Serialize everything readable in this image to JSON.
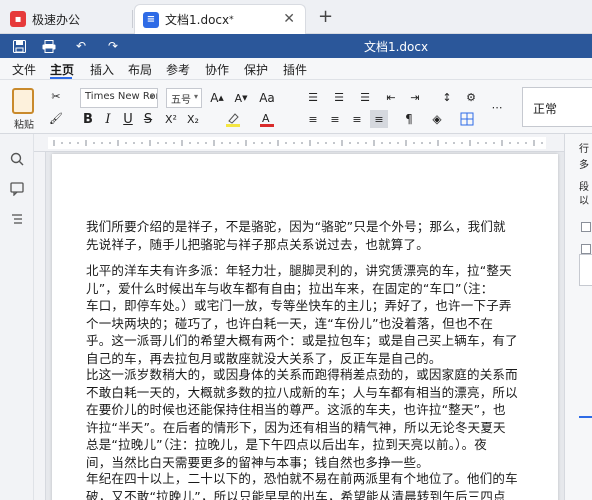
{
  "tabs": [
    {
      "label": "极速办公",
      "icon": "app-logo-icon"
    },
    {
      "label": "文档1.docx",
      "modified_mark": "*",
      "icon": "document-icon"
    }
  ],
  "window": {
    "doc_title": "文档1.docx"
  },
  "menu": {
    "items": [
      "文件",
      "主页",
      "插入",
      "布局",
      "参考",
      "协作",
      "保护",
      "插件"
    ],
    "active": "主页"
  },
  "ribbon": {
    "paste_label": "粘贴",
    "font_name": "Times New Roma",
    "font_size": "五号",
    "style_name": "正常",
    "accent_color": "#2e6be6",
    "highlight_color": "#f5e642",
    "font_color": "#d92b2b"
  },
  "right_panel": {
    "labels": [
      "行",
      "多",
      "段",
      "以"
    ]
  },
  "document": {
    "paragraphs": [
      [
        "我们所要介绍的是祥子，不是骆驼，因为“骆驼”只是个外号；那么，我们就",
        "先说祥子，随手儿把骆驼与祥子那点关系说过去，也就算了。"
      ],
      [
        "北平的洋车夫有许多派：年轻力壮，腿脚灵利的，讲究赁漂亮的车，拉“整天",
        "儿”，爱什么时候出车与收车都有自由；拉出车来，在固定的“车口”（注：",
        "车口，即停车处。）或宅门一放，专等坐快车的主儿；弄好了，也许一下子弄",
        "个一块两块的；碰巧了，也许白耗一天，连“车份儿”也没着落，但也不在",
        "乎。这一派哥儿们的希望大概有两个：或是拉包车；或是自己买上辆车，有了",
        "自己的车，再去拉包月或散座就没大关系了，反正车是自己的。"
      ],
      [
        "比这一派岁数稍大的，或因身体的关系而跑得稍差点劲的，或因家庭的关系而",
        "不敢白耗一天的，大概就多数的拉八成新的车；人与车都有相当的漂亮，所以",
        "在要价儿的时候也还能保持住相当的尊严。这派的车夫，也许拉“整天”，也",
        "许拉“半天”。在后者的情形下，因为还有相当的精气神，所以无论冬天夏天",
        "总是“拉晚儿”（注：拉晚儿，是下午四点以后出车，拉到天亮以前。）。夜",
        "间，当然比白天需要更多的留神与本事；钱自然也多挣一些。"
      ],
      [
        "年纪在四十以上，二十以下的，恐怕就不易在前两派里有个地位了。他们的车",
        "破，又不敢“拉晚儿”，所以只能早早的出车，希望能从清晨转到午后三四点"
      ]
    ]
  }
}
